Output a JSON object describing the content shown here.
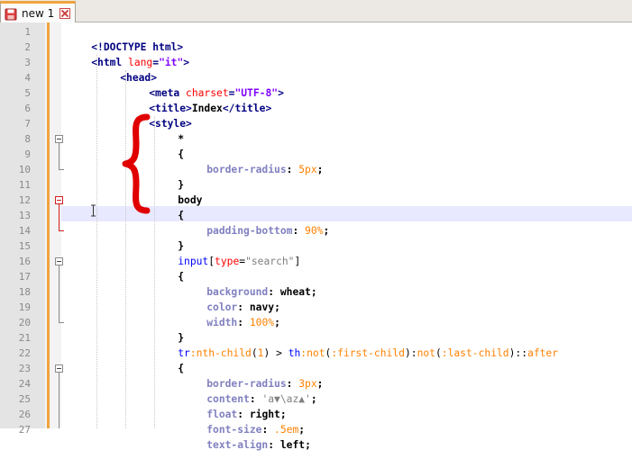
{
  "tab": {
    "label": "new 1",
    "icon": "save-disk-icon",
    "close_icon": "close-icon"
  },
  "colors": {
    "accent": "#f0a340",
    "tag": "#000080",
    "attribute": "#ff0000",
    "string": "#8000ff",
    "property": "#8080c0",
    "number": "#ff8000",
    "annotation": "#e00000",
    "current_line": "#e8e8ff"
  },
  "line_numbers": [
    "1",
    "2",
    "3",
    "4",
    "5",
    "6",
    "7",
    "8",
    "9",
    "10",
    "11",
    "12",
    "13",
    "14",
    "15",
    "16",
    "17",
    "18",
    "19",
    "20",
    "21",
    "22",
    "23",
    "24",
    "25",
    "26",
    "27"
  ],
  "current_line": 13,
  "code": {
    "l1": "<!DOCTYPE html>",
    "l2_open": "<html ",
    "l2_attr": "lang",
    "l2_eq": "=",
    "l2_val": "\"it\"",
    "l2_close": ">",
    "l3": "<head>",
    "l4_open": "<meta ",
    "l4_attr": "charset",
    "l4_eq": "=",
    "l4_val": "\"UTF-8\"",
    "l4_close": ">",
    "l5_open": "<title>",
    "l5_text": "Index",
    "l5_close": "</title>",
    "l6": "<style>",
    "l7": "*",
    "l8": "{",
    "l9_prop": "border-radius",
    "l9_colon": ": ",
    "l9_num": "5px",
    "l9_end": ";",
    "l10": "}",
    "l11": "body",
    "l12": "{",
    "l13_prop": "padding-bottom",
    "l13_colon": ": ",
    "l13_num": "90%",
    "l13_end": ";",
    "l14": "}",
    "l15_sel": "input",
    "l15_b1": "[",
    "l15_attr": "type",
    "l15_eq": "=",
    "l15_val": "\"search\"",
    "l15_b2": "]",
    "l16": "{",
    "l17_prop": "background",
    "l17_colon": ": ",
    "l17_val": "wheat",
    "l17_end": ";",
    "l18_prop": "color",
    "l18_colon": ": ",
    "l18_val": "navy",
    "l18_end": ";",
    "l19_prop": "width",
    "l19_colon": ": ",
    "l19_num": "100%",
    "l19_end": ";",
    "l20": "}",
    "l21_a": "tr",
    "l21_b": ":nth-child",
    "l21_c": "(",
    "l21_d": "1",
    "l21_e": ") > ",
    "l21_f": "th",
    "l21_g": ":not",
    "l21_h": "(",
    "l21_i": ":first-child",
    "l21_j": "):",
    "l21_k": "not",
    "l21_l": "(",
    "l21_m": ":last-child",
    "l21_n": ")::",
    "l21_o": "after",
    "l22": "{",
    "l23_prop": "border-radius",
    "l23_colon": ": ",
    "l23_num": "3px",
    "l23_end": ";",
    "l24_prop": "content",
    "l24_colon": ": ",
    "l24_val": "'a▼\\az▲'",
    "l24_end": ";",
    "l25_prop": "float",
    "l25_colon": ": ",
    "l25_val": "right",
    "l25_end": ";",
    "l26_prop": "font-size",
    "l26_colon": ": ",
    "l26_num": ".5em",
    "l26_end": ";",
    "l27_prop": "text-align",
    "l27_colon": ": ",
    "l27_val": "left",
    "l27_end": ";"
  }
}
